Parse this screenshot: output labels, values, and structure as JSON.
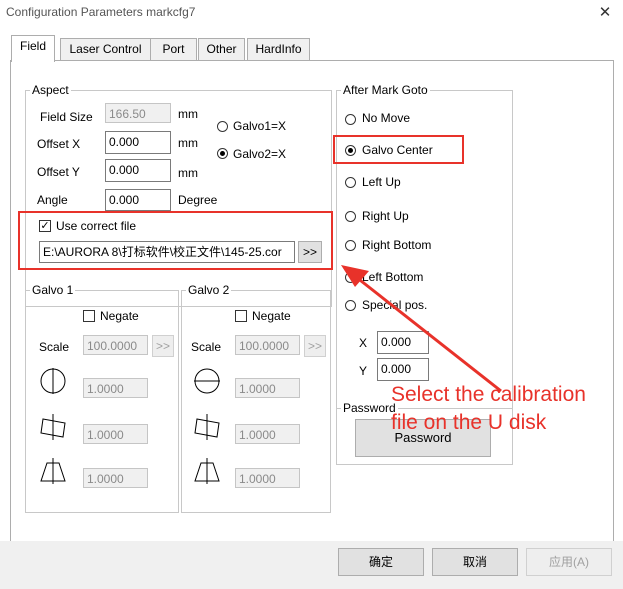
{
  "window": {
    "title": "Configuration Parameters markcfg7",
    "close_glyph": "✕"
  },
  "tabs": [
    "Field",
    "Laser Control",
    "Port",
    "Other",
    "HardInfo"
  ],
  "aspect": {
    "legend": "Aspect",
    "field_size": {
      "label": "Field Size",
      "value": "166.50",
      "unit": "mm"
    },
    "offset_x": {
      "label": "Offset X",
      "value": "0.000",
      "unit": "mm"
    },
    "offset_y": {
      "label": "Offset Y",
      "value": "0.000",
      "unit": "mm"
    },
    "angle": {
      "label": "Angle",
      "value": "0.000",
      "unit": "Degree"
    },
    "galvo1_radio": "Galvo1=X",
    "galvo2_radio": "Galvo2=X",
    "use_correct_file": {
      "label": "Use correct file",
      "path": "E:\\AURORA 8\\打标软件\\校正文件\\145-25.cor",
      "browse": ">>"
    }
  },
  "galvo1": {
    "legend": "Galvo 1",
    "negate": "Negate",
    "scale_label": "Scale",
    "scale_value": "100.0000",
    "scale_btn": ">>",
    "values": [
      "1.0000",
      "1.0000",
      "1.0000"
    ]
  },
  "galvo2": {
    "legend": "Galvo 2",
    "negate": "Negate",
    "scale_label": "Scale",
    "scale_value": "100.0000",
    "scale_btn": ">>",
    "values": [
      "1.0000",
      "1.0000",
      "1.0000"
    ]
  },
  "after_mark": {
    "legend": "After Mark Goto",
    "options": [
      "No Move",
      "Galvo Center",
      "Left Up",
      "Right Up",
      "Right Bottom",
      "Left Bottom",
      "Special pos."
    ],
    "selected": "Galvo Center",
    "x_label": "X",
    "x_value": "0.000",
    "y_label": "Y",
    "y_value": "0.000"
  },
  "password": {
    "legend": "Password",
    "button": "Password"
  },
  "footer": {
    "ok": "确定",
    "cancel": "取消",
    "apply": "应用(A)"
  },
  "annotation": {
    "line1": "Select the calibration",
    "line2": "file on the U disk",
    "color": "#e8322a"
  }
}
